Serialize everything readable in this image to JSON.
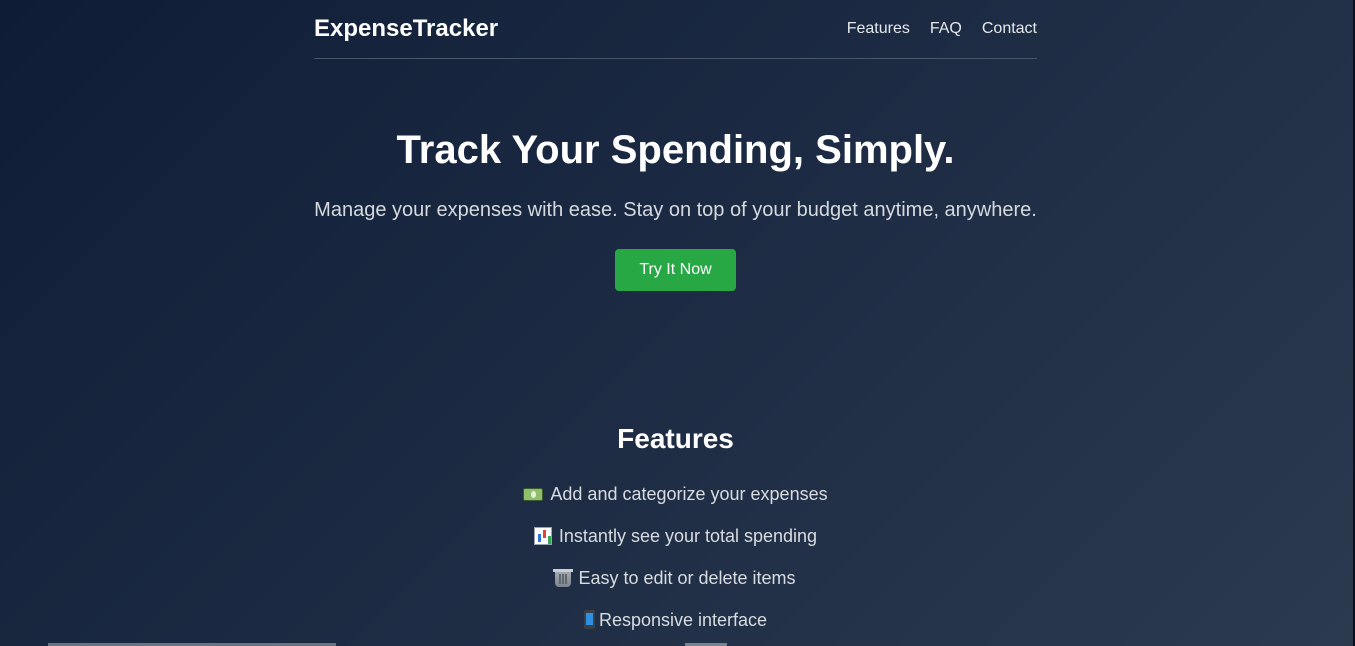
{
  "nav": {
    "brand": "ExpenseTracker",
    "links": [
      {
        "label": "Features"
      },
      {
        "label": "FAQ"
      },
      {
        "label": "Contact"
      }
    ]
  },
  "hero": {
    "title": "Track Your Spending, Simply.",
    "subtitle": "Manage your expenses with ease. Stay on top of your budget anytime, anywhere.",
    "cta_label": "Try It Now"
  },
  "features": {
    "title": "Features",
    "items": [
      {
        "icon": "money-icon",
        "label": "Add and categorize your expenses"
      },
      {
        "icon": "bar-chart-icon",
        "label": "Instantly see your total spending"
      },
      {
        "icon": "trash-icon",
        "label": "Easy to edit or delete items"
      },
      {
        "icon": "mobile-phone-icon",
        "label": "Responsive interface"
      }
    ]
  },
  "colors": {
    "background_start": "#0f1c36",
    "background_end": "#2c3a50",
    "cta": "#28a745"
  }
}
